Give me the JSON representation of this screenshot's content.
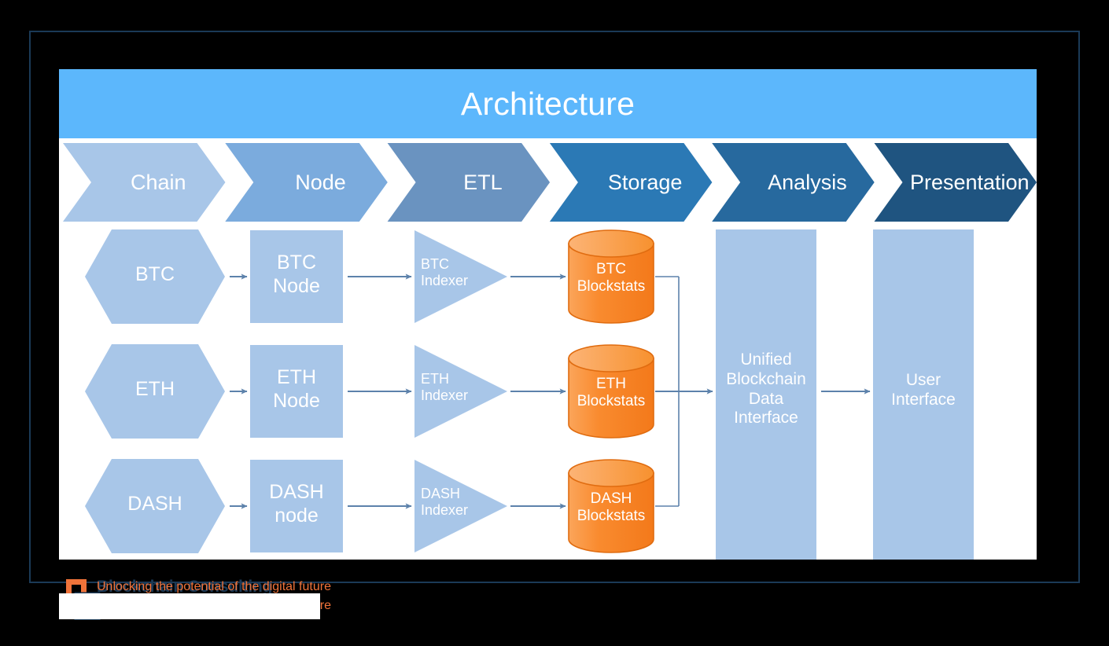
{
  "slide": {
    "title": "Architecture",
    "background_color": "#000000",
    "panel_color": "#ffffff",
    "border_color": "#1b3a57",
    "title_bar_color": "#5cb7fc"
  },
  "stages": [
    {
      "label": "Chain",
      "color": "#a8c6e8"
    },
    {
      "label": "Node",
      "color": "#7babdd"
    },
    {
      "label": "ETL",
      "color": "#6a93c0"
    },
    {
      "label": "Storage",
      "color": "#2b79b5"
    },
    {
      "label": "Analysis",
      "color": "#27699e"
    },
    {
      "label": "Presentation",
      "color": "#1f5480"
    }
  ],
  "diagram": {
    "shape_fill": "#a8c6e8",
    "cylinder_fill_light": "#fba55a",
    "cylinder_fill_dark": "#f3791a",
    "cylinder_stroke": "#e06c10",
    "connector_color": "#5d82ab",
    "rows": [
      {
        "chain": "BTC",
        "node": "BTC\nNode",
        "indexer": "BTC\nIndexer",
        "storage": "BTC\nBlockstats"
      },
      {
        "chain": "ETH",
        "node": "ETH\nNode",
        "indexer": "ETH\nIndexer",
        "storage": "ETH\nBlockstats"
      },
      {
        "chain": "DASH",
        "node": "DASH\nnode",
        "indexer": "DASH\nIndexer",
        "storage": "DASH\nBlockstats"
      }
    ],
    "analysis": "Unified\nBlockchain\nData\nInterface",
    "presentation": "User\nInterface"
  },
  "footer": {
    "logo_title": "Blockchain Consulting",
    "logo_tagline": "Unlocking the potential of the digital future",
    "logo_color_orange": "#f0733a",
    "logo_color_navy": "#1b3a57"
  }
}
